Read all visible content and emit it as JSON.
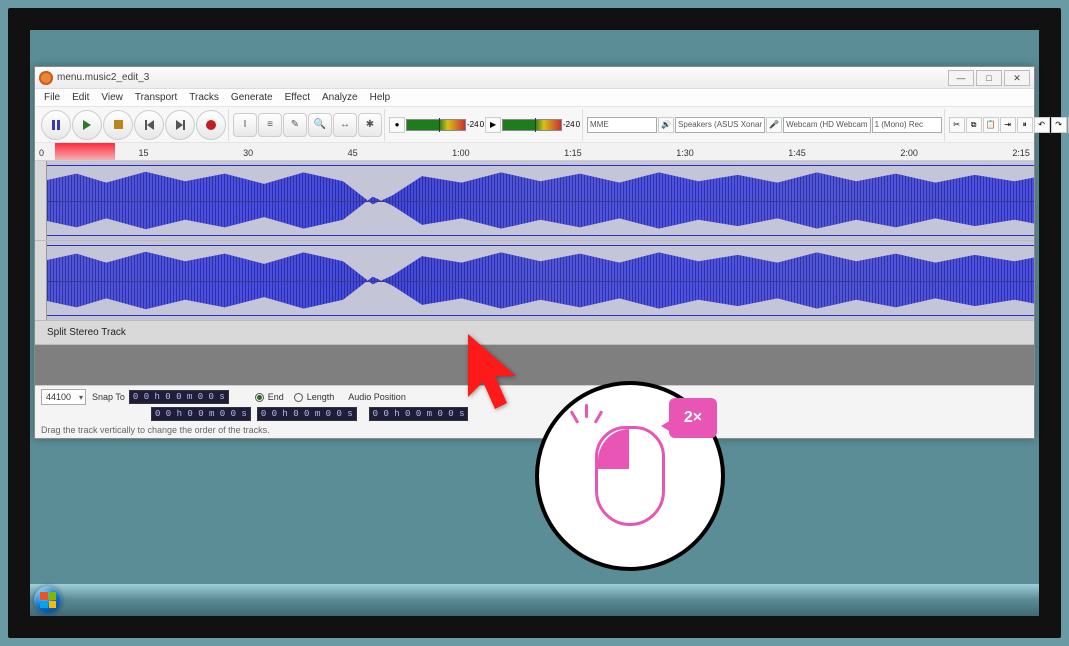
{
  "window": {
    "title": "menu.music2_edit_3",
    "win_min": "—",
    "win_max": "□",
    "win_close": "✕"
  },
  "menu": {
    "items": [
      "File",
      "Edit",
      "View",
      "Transport",
      "Tracks",
      "Generate",
      "Effect",
      "Analyze",
      "Help"
    ]
  },
  "toolbar": {
    "db_labels": [
      "-24",
      "0",
      "-24",
      "0"
    ],
    "host_label": "MME",
    "output_device": "Speakers (ASUS Xonar",
    "input_device": "Webcam (HD Webcam",
    "channels": "1 (Mono) Rec"
  },
  "ruler": {
    "labels": [
      "0",
      "15",
      "30",
      "45",
      "1:00",
      "1:15",
      "1:30",
      "1:45",
      "2:00",
      "2:15"
    ]
  },
  "track": {
    "label": "Split Stereo Track"
  },
  "footer": {
    "rate_label": "44100",
    "snap_label": "Snap To",
    "snap_value": "0 0 h 0 0 m 0 0 s",
    "radio_end": "End",
    "radio_length": "Length",
    "audio_pos_label": "Audio Position",
    "sel1": "0 0 h 0 0 m 0 0 s",
    "sel2": "0 0 h 0 0 m 0 0 s",
    "status": "Drag the track vertically to change the order of the tracks."
  },
  "overlay": {
    "x2": "2×"
  }
}
